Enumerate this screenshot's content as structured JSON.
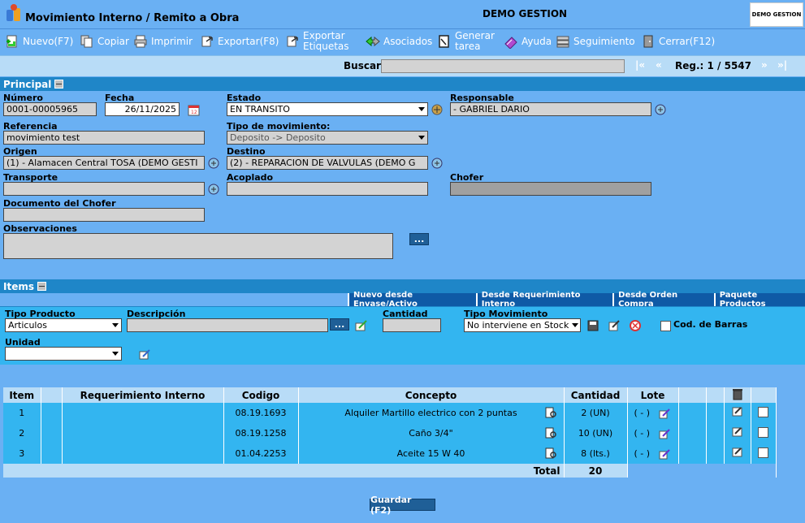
{
  "header": {
    "title": "Movimiento Interno / Remito a Obra",
    "company": "DEMO GESTION",
    "logo_text": "DEMO GESTION"
  },
  "toolbar": {
    "nuevo": "Nuevo(F7)",
    "copiar": "Copiar",
    "imprimir": "Imprimir",
    "exportar": "Exportar(F8)",
    "exportar_etiquetas_1": "Exportar",
    "exportar_etiquetas_2": "Etiquetas",
    "asociados": "Asociados",
    "generar_tarea_1": "Generar",
    "generar_tarea_2": "tarea",
    "ayuda": "Ayuda",
    "seguimiento": "Seguimiento",
    "cerrar": "Cerrar(F12)"
  },
  "search": {
    "label": "Buscar",
    "value": "",
    "first": "|«",
    "prev": "«",
    "reg": "Reg.: 1 / 5547",
    "next": "»",
    "last": "»|"
  },
  "principal": {
    "title": "Principal",
    "numero_label": "Número",
    "numero": "0001-00005965",
    "fecha_label": "Fecha",
    "fecha": "26/11/2025",
    "estado_label": "Estado",
    "estado": "EN TRANSITO",
    "responsable_label": "Responsable",
    "responsable": "- GABRIEL DARIO",
    "referencia_label": "Referencia",
    "referencia": "movimiento test",
    "tipo_mov_label": "Tipo de movimiento:",
    "tipo_mov": "Deposito -> Deposito",
    "origen_label": "Origen",
    "origen": "(1) - Alamacen Central TOSA (DEMO GESTI",
    "destino_label": "Destino",
    "destino": "(2) - REPARACION DE VALVULAS  (DEMO G",
    "transporte_label": "Transporte",
    "transporte": "",
    "acoplado_label": "Acoplado",
    "acoplado": "",
    "chofer_label": "Chofer",
    "chofer": "",
    "doc_chofer_label": "Documento del Chofer",
    "doc_chofer": "",
    "observaciones_label": "Observaciones",
    "observaciones": "",
    "more_btn": "..."
  },
  "items": {
    "title": "Items",
    "tab_envase": "Nuevo desde Envase/Activo",
    "tab_req": "Desde Requerimiento Interno",
    "tab_oc": "Desde Orden Compra",
    "tab_paquete": "Paquete Productos",
    "tipo_prod_label": "Tipo Producto",
    "tipo_prod": "Articulos",
    "descripcion_label": "Descripción",
    "descripcion": "",
    "desc_btn": "...",
    "cantidad_label": "Cantidad",
    "cantidad": "",
    "tipo_mov_label": "Tipo Movimiento",
    "tipo_mov": "No interviene en Stock",
    "cod_barras_label": "Cod. de Barras",
    "unidad_label": "Unidad",
    "unidad": ""
  },
  "grid": {
    "headers": {
      "item": "Item",
      "req": "Requerimiento Interno",
      "codigo": "Codigo",
      "concepto": "Concepto",
      "cantidad": "Cantidad",
      "lote": "Lote"
    },
    "rows": [
      {
        "item": "1",
        "codigo": "08.19.1693",
        "concepto": "Alquiler Martillo electrico con 2 puntas",
        "cantidad": "2 (UN)",
        "lote": "( - )"
      },
      {
        "item": "2",
        "codigo": "08.19.1258",
        "concepto": "Caño 3/4\"",
        "cantidad": "10 (UN)",
        "lote": "( - )"
      },
      {
        "item": "3",
        "codigo": "01.04.2253",
        "concepto": "Aceite 15 W 40",
        "cantidad": "8 (lts.)",
        "lote": "( - )"
      }
    ],
    "total_label": "Total",
    "total": "20"
  },
  "save_btn": "Guardar (F2)"
}
